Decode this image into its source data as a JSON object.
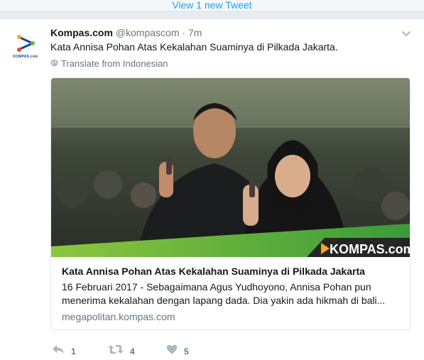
{
  "banner": {
    "label": "View 1 new Tweet"
  },
  "tweet": {
    "avatar_caption": "KOMPAS.com",
    "name": "Kompas.com",
    "handle": "@kompascom",
    "separator": "·",
    "time": "7m",
    "text": "Kata Annisa Pohan Atas Kekalahan Suaminya di Pilkada Jakarta.",
    "translate_label": "Translate from Indonesian",
    "card": {
      "image_watermark": "KOMPAS.com",
      "title": "Kata Annisa Pohan Atas Kekalahan Suaminya di Pilkada Jakarta",
      "description_line1": "16 Februari 2017 - Sebagaimana Agus Yudhoyono, Annisa Pohan pun",
      "description_line2": "menerima kekalahan dengan lapang dada. Dia yakin ada hikmah di bali...",
      "domain": "megapolitan.kompas.com"
    },
    "actions": {
      "reply_count": "1",
      "retweet_count": "4",
      "like_count": "5"
    }
  },
  "colors": {
    "link": "#1da1f2",
    "secondary_text": "#657786",
    "border": "#e1e8ed",
    "icon": "#aab8c2",
    "kompas_blue": "#0e4a96",
    "kompas_orange": "#f5a623",
    "kompas_green": "#5fbf3a"
  },
  "icons": [
    "kompas-logo-icon",
    "chevron-down-icon",
    "globe-icon",
    "reply-icon",
    "retweet-icon",
    "heart-icon"
  ]
}
